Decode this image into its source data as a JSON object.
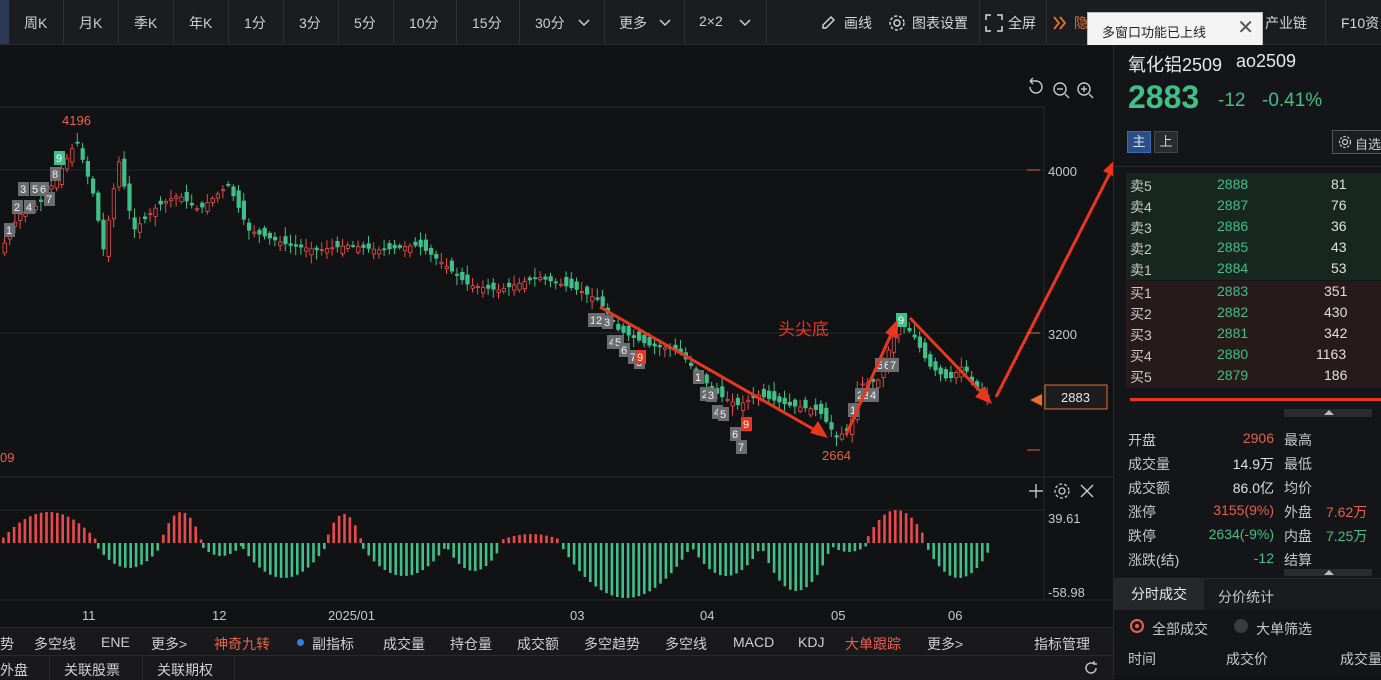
{
  "toolbar": {
    "periods": [
      "周K",
      "月K",
      "季K",
      "年K",
      "1分",
      "3分",
      "5分",
      "10分",
      "15分",
      "30分",
      "更多",
      "2×2"
    ],
    "draw_label": "画线",
    "settings_label": "图表设置",
    "fullscreen_label": "全屏",
    "hidden_label": "隐",
    "industry_label": "产业链",
    "f10_label": "F10资"
  },
  "tooltip": {
    "text": "多窗口功能已上线"
  },
  "chart": {
    "price_axis": [
      "4000",
      "3200"
    ],
    "current_price_tag": "2883",
    "high_label": "4196",
    "low_label": "2664",
    "left_edge_label": "09",
    "annotation": "头尖底",
    "indicator_axis": [
      "39.61",
      "-58.98"
    ],
    "x_labels": [
      "11",
      "12",
      "2025/01",
      "03",
      "04",
      "05",
      "06"
    ],
    "colors": {
      "up": "#e84a4a",
      "down": "#3fbf8a",
      "arrow": "#e8371d"
    },
    "td_sequences": [
      {
        "color": "gray",
        "items": [
          "1",
          "2",
          "3",
          "4",
          "5",
          "6",
          "7",
          "8"
        ]
      },
      {
        "color": "gray",
        "items": [
          "1",
          "2",
          "3",
          "4",
          "5",
          "6",
          "7",
          "8"
        ]
      },
      {
        "color": "gray",
        "items": [
          "1",
          "2",
          "3",
          "4",
          "5",
          "6",
          "7"
        ]
      },
      {
        "color": "gray",
        "items": [
          "1",
          "2",
          "3",
          "4",
          "5",
          "6",
          "7"
        ]
      }
    ],
    "nine_labels": [
      "9",
      "9",
      "9",
      "9"
    ]
  },
  "indicator_bar": {
    "items": [
      "势",
      "多空线",
      "ENE",
      "更多>",
      "神奇九转",
      "副指标",
      "成交量",
      "持仓量",
      "成交额",
      "多空趋势",
      "多空线",
      "MACD",
      "KDJ",
      "大单跟踪",
      "更多>",
      "指标管理"
    ]
  },
  "bottom_tabs": [
    "外盘",
    "关联股票",
    "关联期权"
  ],
  "quote": {
    "name": "氧化铝2509",
    "code": "ao2509",
    "price": "2883",
    "change": "-12",
    "change_pct": "-0.41%",
    "tab_main": "主",
    "tab_up": "上",
    "watch_label": "自选",
    "asks": [
      {
        "label": "卖5",
        "price": "2888",
        "vol": "81"
      },
      {
        "label": "卖4",
        "price": "2887",
        "vol": "76"
      },
      {
        "label": "卖3",
        "price": "2886",
        "vol": "36"
      },
      {
        "label": "卖2",
        "price": "2885",
        "vol": "43"
      },
      {
        "label": "卖1",
        "price": "2884",
        "vol": "53"
      }
    ],
    "bids": [
      {
        "label": "买1",
        "price": "2883",
        "vol": "351"
      },
      {
        "label": "买2",
        "price": "2882",
        "vol": "430"
      },
      {
        "label": "买3",
        "price": "2881",
        "vol": "342"
      },
      {
        "label": "买4",
        "price": "2880",
        "vol": "1163"
      },
      {
        "label": "买5",
        "price": "2879",
        "vol": "186"
      }
    ],
    "stats": [
      {
        "k": "开盘",
        "v": "2906",
        "k2": "最高",
        "v2": ""
      },
      {
        "k": "成交量",
        "v": "14.9万",
        "k2": "最低",
        "v2": ""
      },
      {
        "k": "成交额",
        "v": "86.0亿",
        "k2": "均价",
        "v2": ""
      },
      {
        "k": "涨停",
        "v": "3155(9%)",
        "k2": "外盘",
        "v2": "7.62万"
      },
      {
        "k": "跌停",
        "v": "2634(-9%)",
        "k2": "内盘",
        "v2": "7.25万"
      },
      {
        "k": "涨跌(结)",
        "v": "-12",
        "k2": "结算",
        "v2": ""
      }
    ],
    "trade_tabs": [
      "分时成交",
      "分价统计"
    ],
    "filter_all": "全部成交",
    "filter_big": "大单筛选",
    "col_time": "时间",
    "col_price": "成交价",
    "col_vol": "成交量"
  }
}
